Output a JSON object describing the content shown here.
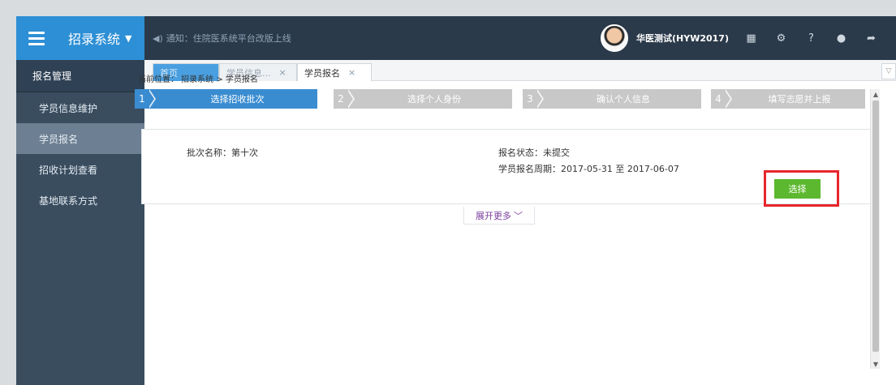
{
  "header": {
    "app_title": "招录系统",
    "notice_icon": "speaker-icon",
    "notice_text": "通知：住院医系统平台改版上线",
    "user_name": "华医测试(HYW2017)",
    "tool_icons": [
      "calendar-icon",
      "gear-icon",
      "help-icon",
      "user-icon",
      "logout-icon"
    ]
  },
  "sidebar": {
    "heading": "报名管理",
    "items": [
      {
        "label": "学员信息维护"
      },
      {
        "label": "学员报名"
      },
      {
        "label": "招收计划查看"
      },
      {
        "label": "基地联系方式"
      }
    ]
  },
  "tabs": [
    {
      "label": "首页"
    },
    {
      "label": "学员信息..."
    },
    {
      "label": "学员报名"
    }
  ],
  "breadcrumb": "当前位置： 招录系统 > 学员报名",
  "steps": [
    {
      "num": "1",
      "label": "选择招收批次"
    },
    {
      "num": "2",
      "label": "选择个人身份"
    },
    {
      "num": "3",
      "label": "确认个人信息"
    },
    {
      "num": "4",
      "label": "填写志愿并上报"
    }
  ],
  "batch": {
    "name": "批次名称：第十次",
    "status": "报名状态：未提交",
    "period": "学员报名周期：2017-05-31 至 2017-06-07",
    "select_label": "选择"
  },
  "expand_label": "展开更多",
  "colors": {
    "header_bg": "#2b3a4a",
    "brand_blue": "#2d8fd5",
    "step_active": "#3a8cd1",
    "step_inactive": "#c8c8c8",
    "select_green": "#5cb82e",
    "highlight_red": "#e8262b"
  }
}
